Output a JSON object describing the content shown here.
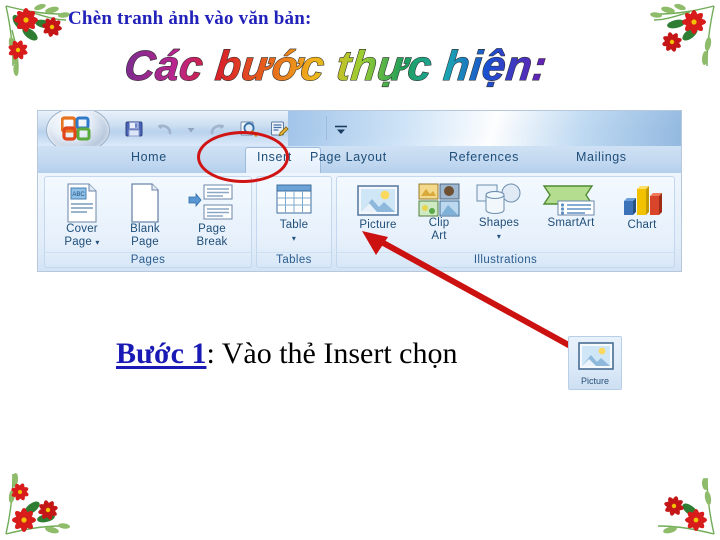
{
  "slide": {
    "title": "Chèn tranh ảnh vào văn bản:",
    "wordart_text": "Các bước thực hiện:",
    "title_color": "#2222bb",
    "background": "#ffffff"
  },
  "decorations": [
    {
      "name": "poinsettia-corner-top-left"
    },
    {
      "name": "poinsettia-corner-top-right"
    },
    {
      "name": "poinsettia-corner-bottom-left"
    },
    {
      "name": "poinsettia-corner-bottom-right"
    }
  ],
  "ribbon": {
    "office_button": "office-orb-icon",
    "quick_access": [
      {
        "name": "save-icon",
        "label": "Save"
      },
      {
        "name": "undo-icon",
        "label": "Undo"
      },
      {
        "name": "undo-dropdown-icon",
        "label": "Undo options"
      },
      {
        "name": "redo-icon",
        "label": "Redo"
      },
      {
        "name": "print-preview-icon",
        "label": "Print Preview"
      },
      {
        "name": "quick-print-icon",
        "label": "Quick Print"
      }
    ],
    "customize_label": "Customize Quick Access Toolbar",
    "tabs": [
      {
        "label": "Home",
        "selected": false
      },
      {
        "label": "Insert",
        "selected": true
      },
      {
        "label": "Page Layout",
        "selected": false
      },
      {
        "label": "References",
        "selected": false
      },
      {
        "label": "Mailings",
        "selected": false
      }
    ],
    "groups": [
      {
        "name": "Pages",
        "commands": [
          {
            "label_line1": "Cover",
            "label_line2": "Page",
            "has_dropdown": true,
            "icon": "cover-page-icon"
          },
          {
            "label_line1": "Blank",
            "label_line2": "Page",
            "has_dropdown": false,
            "icon": "blank-page-icon"
          },
          {
            "label_line1": "Page",
            "label_line2": "Break",
            "has_dropdown": false,
            "icon": "page-break-icon"
          }
        ]
      },
      {
        "name": "Tables",
        "commands": [
          {
            "label_line1": "Table",
            "label_line2": "",
            "has_dropdown": true,
            "icon": "table-icon"
          }
        ]
      },
      {
        "name": "Illustrations",
        "commands": [
          {
            "label_line1": "Picture",
            "label_line2": "",
            "has_dropdown": false,
            "icon": "picture-icon"
          },
          {
            "label_line1": "Clip",
            "label_line2": "Art",
            "has_dropdown": false,
            "icon": "clip-art-icon"
          },
          {
            "label_line1": "Shapes",
            "label_line2": "",
            "has_dropdown": true,
            "icon": "shapes-icon"
          },
          {
            "label_line1": "SmartArt",
            "label_line2": "",
            "has_dropdown": false,
            "icon": "smartart-icon"
          },
          {
            "label_line1": "Chart",
            "label_line2": "",
            "has_dropdown": false,
            "icon": "chart-icon"
          }
        ]
      }
    ]
  },
  "annotations": {
    "ellipse_target": "Insert",
    "ellipse_color": "#d01414",
    "arrow_color": "#cc1111",
    "arrow_target": "Picture"
  },
  "step": {
    "label": "Bước 1",
    "label_color": "#1919b5",
    "rest": ": Vào thẻ Insert chọn",
    "picture_button_label": "Picture"
  }
}
